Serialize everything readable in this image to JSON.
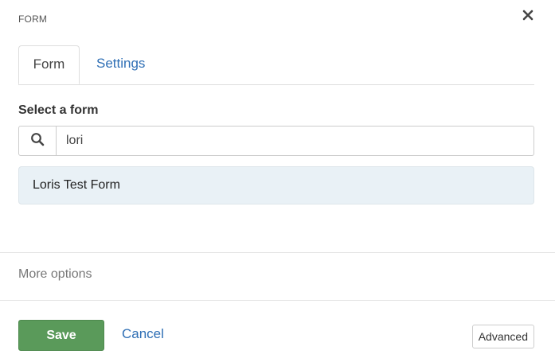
{
  "dialog": {
    "title": "FORM",
    "close_icon": "close-icon"
  },
  "tabs": [
    {
      "label": "Form",
      "active": true
    },
    {
      "label": "Settings",
      "active": false
    }
  ],
  "form_picker": {
    "label": "Select a form",
    "search_icon": "search-icon",
    "search_value": "lori",
    "results": [
      {
        "label": "Loris Test Form"
      }
    ]
  },
  "more_options": {
    "label": "More options"
  },
  "footer": {
    "save_label": "Save",
    "cancel_label": "Cancel",
    "advanced_label": "Advanced"
  },
  "colors": {
    "primary_button": "#5a9a5a",
    "link": "#2f6fb5",
    "result_highlight": "#e9f1f6"
  }
}
